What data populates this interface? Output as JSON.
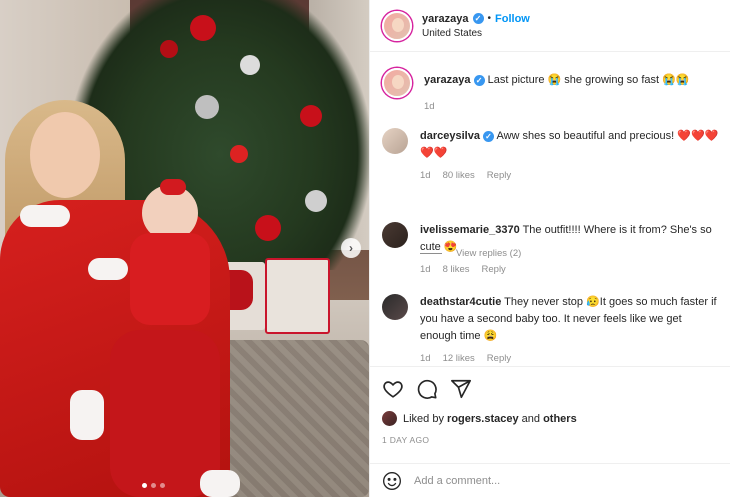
{
  "post": {
    "author": "yarazaya",
    "follow_label": "Follow",
    "separator": "•",
    "location": "United States"
  },
  "caption": {
    "user": "yarazaya",
    "text": "Last picture 😭 she growing so fast 😭😭",
    "time": "1d"
  },
  "comments": [
    {
      "user": "darceysilva",
      "text": "Aww shes so beautiful and precious! ❤️❤️❤️❤️❤️",
      "time": "1d",
      "likes": "80 likes",
      "reply": "Reply"
    },
    {
      "user": "ivelissemarie_3370",
      "text": "The outfit!!!! Where is it from? She's so cute 😍",
      "time": "1d",
      "likes": "8 likes",
      "reply": "Reply"
    },
    {
      "user": "deathstar4cutie",
      "text": "They never stop 😥It goes so much faster if you have a second baby too. It never feels like we get enough time 😩",
      "time": "1d",
      "likes": "12 likes",
      "reply": "Reply"
    }
  ],
  "view_replies": "View replies (2)",
  "likes": {
    "prefix": "Liked by",
    "user": "rogers.stacey",
    "and": "and",
    "others": "others"
  },
  "date": "1 DAY AGO",
  "add_comment": {
    "placeholder": "Add a comment..."
  },
  "icons": [
    "heart-icon",
    "comment-icon",
    "share-icon",
    "emoji-icon",
    "chevron-right-icon",
    "verified-icon"
  ],
  "colors": {
    "link": "#0095f6",
    "verified": "#3897f0",
    "muted": "#8e8e8e",
    "text": "#262626"
  }
}
